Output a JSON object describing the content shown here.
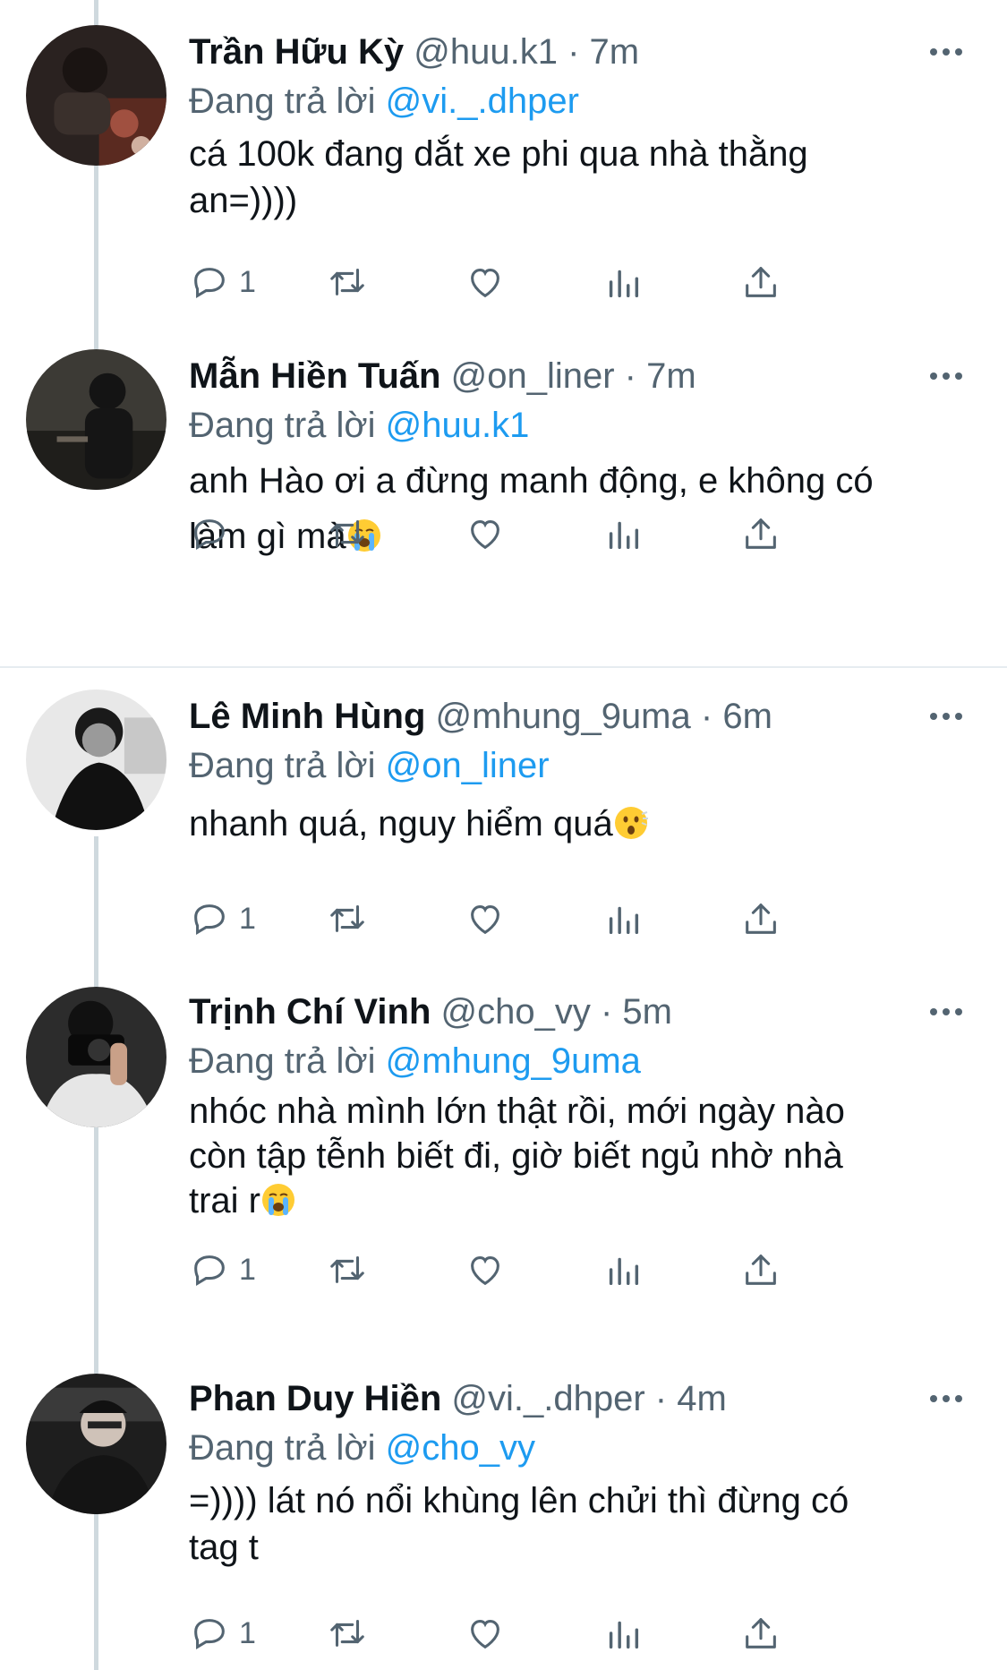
{
  "colors": {
    "link": "#1d9bf0",
    "secondary": "#536471",
    "text": "#0f1419",
    "thread": "#cfd9de"
  },
  "tweets": [
    {
      "name": "Trần Hữu Kỳ",
      "handle": "@huu.k1",
      "dot": "·",
      "time": "7m",
      "reply_label": "Đang trả lời",
      "reply_to": "@vi._.dhper",
      "text": "cá 100k đang dắt xe phi qua nhà thằng\nan=))))",
      "emoji": "",
      "reply_count": "1"
    },
    {
      "name": "Mẫn Hiền Tuấn",
      "handle": "@on_liner",
      "dot": "·",
      "time": "7m",
      "reply_label": "Đang trả lời",
      "reply_to": "@huu.k1",
      "text": "anh Hào ơi a đừng manh động, e không có\nlàm gì mà",
      "emoji": "loudly-crying-face",
      "reply_count": ""
    },
    {
      "name": "Lê Minh Hùng",
      "handle": "@mhung_9uma",
      "dot": "·",
      "time": "6m",
      "reply_label": "Đang trả lời",
      "reply_to": "@on_liner",
      "text": "nhanh quá, nguy hiểm quá",
      "emoji": "face-with-open-mouth",
      "reply_count": "1"
    },
    {
      "name": "Trịnh Chí Vinh",
      "handle": "@cho_vy",
      "dot": "·",
      "time": "5m",
      "reply_label": "Đang trả lời",
      "reply_to": "@mhung_9uma",
      "text": "nhóc nhà mình lớn thật rồi, mới ngày nào\ncòn tập tễnh biết đi, giờ biết ngủ nhờ nhà\ntrai r",
      "emoji": "loudly-crying-face",
      "reply_count": "1"
    },
    {
      "name": "Phan Duy Hiền",
      "handle": "@vi._.dhper",
      "dot": "·",
      "time": "4m",
      "reply_label": "Đang trả lời",
      "reply_to": "@cho_vy",
      "text": "=)))) lát nó nổi khùng lên chửi thì đừng có\ntag t",
      "emoji": "",
      "reply_count": "1"
    }
  ]
}
